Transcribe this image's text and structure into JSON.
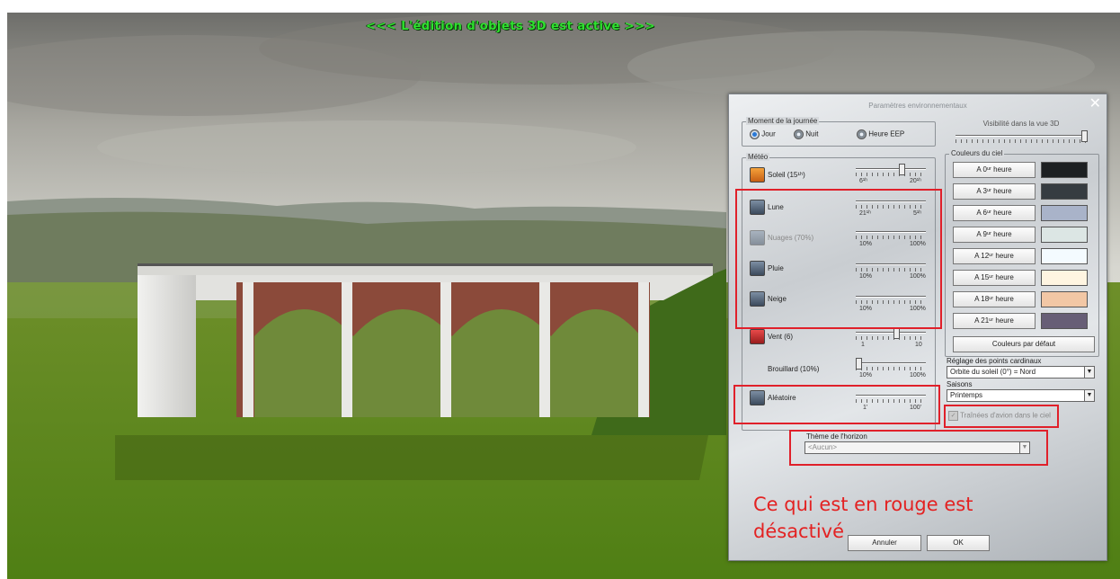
{
  "banner": "<<<  L'édition d'objets 3D est active  >>>",
  "dialog": {
    "title": "Paramètres environnementaux",
    "close": "✕",
    "time_group": {
      "legend": "Moment de la journée",
      "options": [
        {
          "label": "Jour",
          "selected": true
        },
        {
          "label": "Nuit",
          "selected": false
        },
        {
          "label": "Heure EEP",
          "selected": false
        }
      ]
    },
    "visibility_label": "Visibilité dans la vue 3D",
    "weather": {
      "legend": "Météo",
      "sun": {
        "label": "Soleil (15¹ʰ)",
        "min": "6¹ʰ",
        "max": "20¹ʰ"
      },
      "moon": {
        "label": "Lune",
        "min": "21¹ʰ",
        "max": "5¹ʰ"
      },
      "clouds": {
        "label": "Nuages (70%)",
        "min": "10%",
        "max": "100%"
      },
      "rain": {
        "label": "Pluie",
        "min": "10%",
        "max": "100%"
      },
      "snow": {
        "label": "Neige",
        "min": "10%",
        "max": "100%"
      },
      "wind": {
        "label": "Vent (6)",
        "min": "1",
        "max": "10"
      },
      "fog": {
        "label": "Brouillard (10%)",
        "min": "10%",
        "max": "100%"
      },
      "random": {
        "label": "Aléatoire",
        "min": "1'",
        "max": "100'"
      }
    },
    "sky_colors": {
      "legend": "Couleurs du ciel",
      "rows": [
        {
          "label": "A 0ᵘʳ heure",
          "color": "#1d2022"
        },
        {
          "label": "A 3ᵘʳ heure",
          "color": "#363c41"
        },
        {
          "label": "A 6ᵘʳ heure",
          "color": "#a9b3c9"
        },
        {
          "label": "A 9ᵘʳ heure",
          "color": "#dce6e4"
        },
        {
          "label": "A 12ᵘʳ heure",
          "color": "#f4fbff"
        },
        {
          "label": "A 15ᵘʳ heure",
          "color": "#fff5e1"
        },
        {
          "label": "A 18ᵘʳ heure",
          "color": "#f2c7a5"
        },
        {
          "label": "A 21ᵘʳ heure",
          "color": "#675e76"
        }
      ],
      "default_button": "Couleurs par défaut"
    },
    "cardinal": {
      "label": "Réglage des points cardinaux",
      "value": "Orbite du soleil (0°) = Nord"
    },
    "seasons": {
      "label": "Saisons",
      "value": "Printemps"
    },
    "contrails": "Traînées d'avion dans le ciel",
    "horizon": {
      "label": "Thème de l'horizon",
      "value": "<Aucun>"
    },
    "cancel": "Annuler",
    "ok": "OK"
  },
  "note_line1": "Ce qui est en rouge est",
  "note_line2": "désactivé",
  "colors": {
    "annotation_red": "#e0202a",
    "banner_green": "#2fe02f"
  }
}
